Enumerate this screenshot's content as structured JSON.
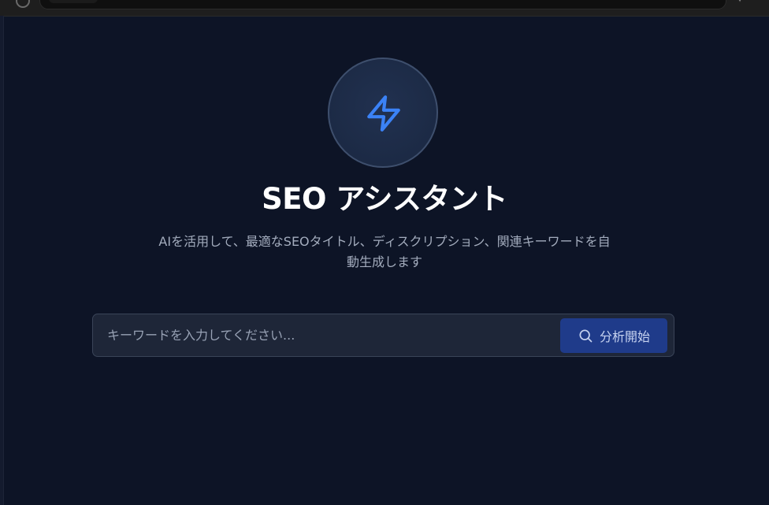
{
  "hero": {
    "icon": "lightning-bolt-icon",
    "title": "SEO アシスタント",
    "subtitle": "AIを活用して、最適なSEOタイトル、ディスクリプション、関連キーワードを自動生成します"
  },
  "search": {
    "placeholder": "キーワードを入力してください...",
    "value": "",
    "button_label": "分析開始",
    "button_icon": "search-icon"
  },
  "colors": {
    "background": "#0d1426",
    "accent": "#3b82f6",
    "button": "#1f3b8a"
  }
}
